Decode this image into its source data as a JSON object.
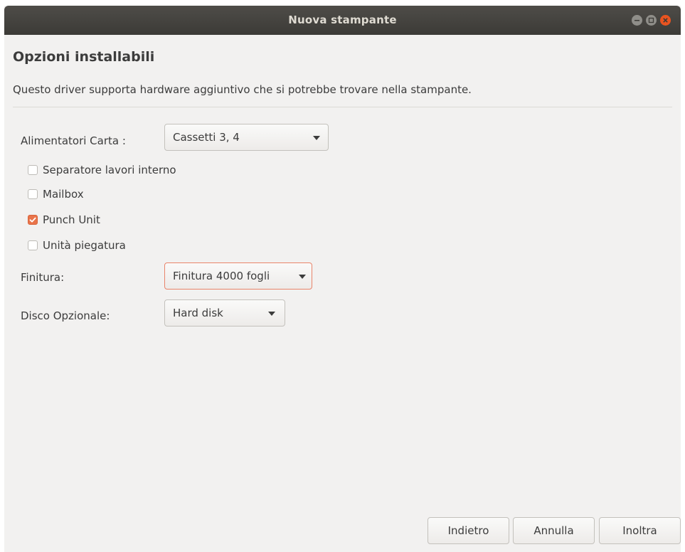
{
  "window": {
    "title": "Nuova stampante",
    "controls": {
      "minimize_icon": "minimize-icon",
      "maximize_icon": "maximize-icon",
      "close_icon": "close-icon"
    }
  },
  "page": {
    "heading": "Opzioni installabili",
    "description": "Questo driver supporta hardware aggiuntivo che si potrebbe trovare nella stampante."
  },
  "options": {
    "paper_feeders": {
      "label": "Alimentatori Carta :",
      "value": "Cassetti 3, 4"
    },
    "checkboxes": [
      {
        "label": "Separatore lavori interno",
        "checked": false
      },
      {
        "label": "Mailbox",
        "checked": false
      },
      {
        "label": "Punch Unit",
        "checked": true
      },
      {
        "label": "Unità piegatura",
        "checked": false
      }
    ],
    "finisher": {
      "label": "Finitura:",
      "value": "Finitura 4000 fogli"
    },
    "optional_disk": {
      "label": "Disco Opzionale:",
      "value": "Hard disk"
    }
  },
  "buttons": {
    "back": "Indietro",
    "cancel": "Annulla",
    "forward": "Inoltra"
  },
  "colors": {
    "accent": "#e95420",
    "checkbox_checked": "#e9744a",
    "titlebar": "#3c3b37",
    "window_bg": "#f2f1f0"
  }
}
